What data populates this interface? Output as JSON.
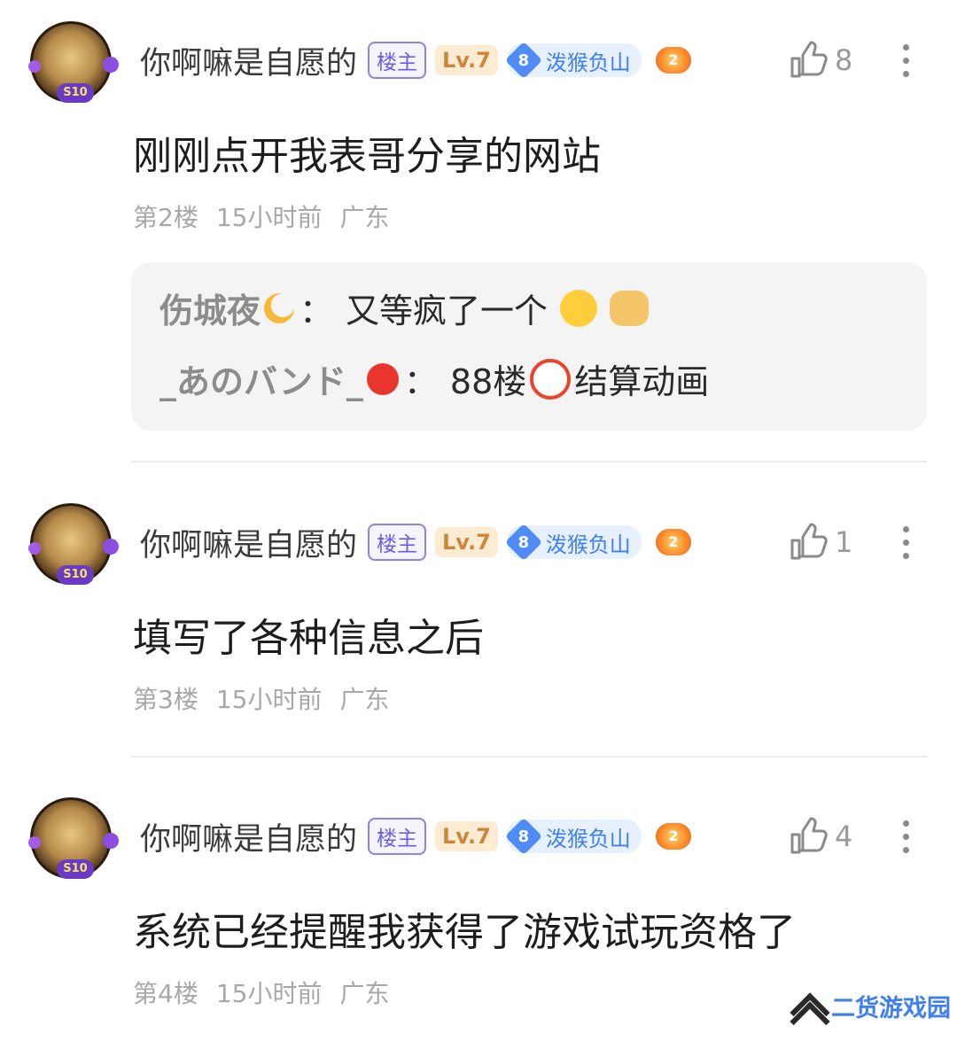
{
  "posts": [
    {
      "username": "你啊嘛是自愿的",
      "owner_tag": "楼主",
      "level": "Lv.7",
      "fan_level": "8",
      "fan_name": "泼猴负山",
      "game_badge_num": "2",
      "likes": "8",
      "content": "刚刚点开我表哥分享的网站",
      "floor": "第2楼",
      "time": "15小时前",
      "location": "广东"
    },
    {
      "username": "你啊嘛是自愿的",
      "owner_tag": "楼主",
      "level": "Lv.7",
      "fan_level": "8",
      "fan_name": "泼猴负山",
      "game_badge_num": "2",
      "likes": "1",
      "content": "填写了各种信息之后",
      "floor": "第3楼",
      "time": "15小时前",
      "location": "广东"
    },
    {
      "username": "你啊嘛是自愿的",
      "owner_tag": "楼主",
      "level": "Lv.7",
      "fan_level": "8",
      "fan_name": "泼猴负山",
      "game_badge_num": "2",
      "likes": "4",
      "content": "系统已经提醒我获得了游戏试玩资格了",
      "floor": "第4楼",
      "time": "15小时前",
      "location": "广东"
    }
  ],
  "replies": [
    {
      "author": "伤城夜",
      "separator": "：",
      "text": "又等疯了一个"
    },
    {
      "author": "_あのバンド_",
      "separator": "：",
      "text_before": "88楼",
      "text_after": "结算动画"
    }
  ],
  "avatar_badge": "S10",
  "watermark": "二货游戏园",
  "colors": {
    "owner_tag": "#6a5cf0",
    "level_tag": "#c8883e",
    "fan_tag": "#3f7ff0",
    "meta_text": "#a8a8a8"
  },
  "icons": {
    "like": "thumbs-up-icon",
    "more": "more-vertical-icon"
  }
}
